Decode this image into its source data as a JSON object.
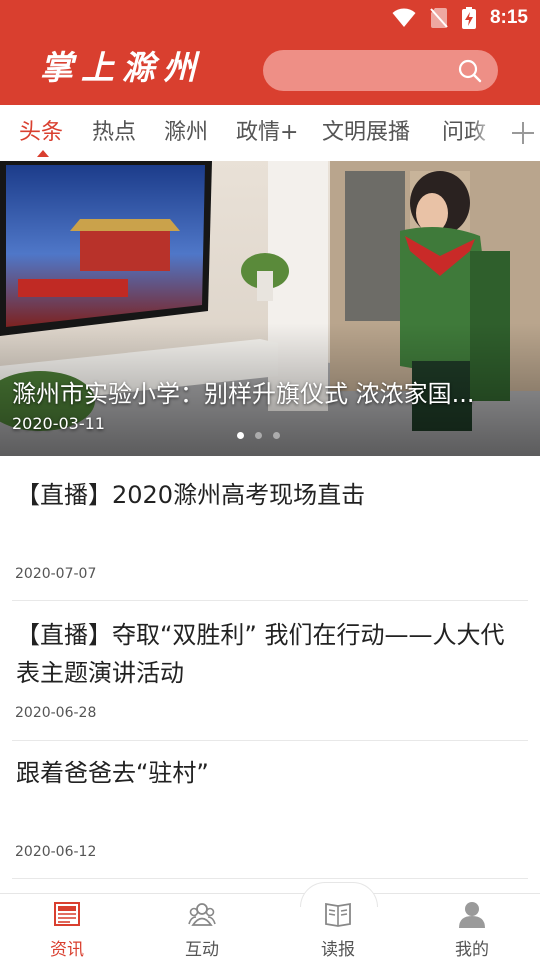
{
  "status_bar": {
    "time": "8:15"
  },
  "header": {
    "app_title": "掌上滁州",
    "search_placeholder": "",
    "brand_color": "#d93f2f",
    "search_bg_color": "#ee8f86"
  },
  "tabs": {
    "items": [
      {
        "label": "头条",
        "active": true
      },
      {
        "label": "热点",
        "active": false
      },
      {
        "label": "滁州",
        "active": false
      },
      {
        "label": "政情+",
        "active": false
      },
      {
        "label": "文明展播",
        "active": false
      },
      {
        "label": "问政",
        "active": false
      }
    ],
    "add_icon": "plus-icon"
  },
  "banner": {
    "title": "滁州市实验小学：别样升旗仪式 浓浓家国...",
    "date": "2020-03-11",
    "slide_count": 3,
    "active_slide": 1
  },
  "news": [
    {
      "title": "【直播】2020滁州高考现场直击",
      "date": "2020-07-07"
    },
    {
      "title": "【直播】夺取“双胜利” 我们在行动——人大代表主题演讲活动",
      "date": "2020-06-28"
    },
    {
      "title": "跟着爸爸去“驻村”",
      "date": "2020-06-12"
    }
  ],
  "bottom_nav": [
    {
      "label": "资讯",
      "icon": "newspaper-icon",
      "active": true
    },
    {
      "label": "互动",
      "icon": "group-icon",
      "active": false
    },
    {
      "label": "读报",
      "icon": "book-icon",
      "active": false
    },
    {
      "label": "我的",
      "icon": "user-icon",
      "active": false
    }
  ]
}
